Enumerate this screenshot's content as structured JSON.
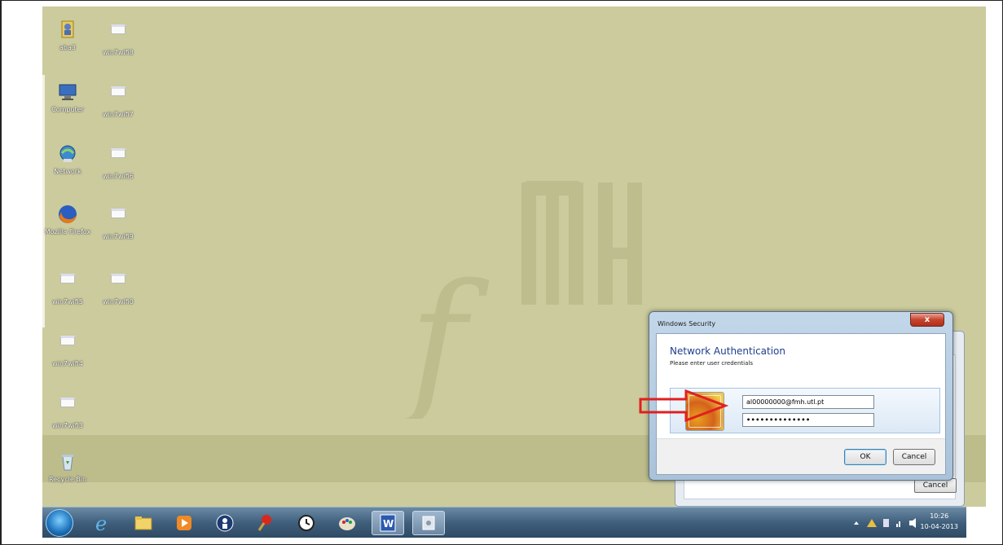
{
  "desktop": {
    "icons": [
      {
        "label": "aba3",
        "icon": "user-folder-icon"
      },
      {
        "label": "win7wifi8",
        "icon": "window-icon"
      },
      {
        "label": "Computer",
        "icon": "computer-icon"
      },
      {
        "label": "win7wifi7",
        "icon": "window-icon"
      },
      {
        "label": "Network",
        "icon": "network-icon"
      },
      {
        "label": "win7wifi6",
        "icon": "window-icon"
      },
      {
        "label": "Mozilla Firefox",
        "icon": "firefox-icon"
      },
      {
        "label": "win7wifi9",
        "icon": "window-icon"
      },
      {
        "label": "win7wifi5",
        "icon": "window-icon"
      },
      {
        "label": "win7wifi0",
        "icon": "window-icon"
      },
      {
        "label": "win7wifi4",
        "icon": "window-icon"
      },
      {
        "label": "win7wifi3",
        "icon": "window-icon"
      },
      {
        "label": "Recycle Bin",
        "icon": "recycle-bin-icon"
      }
    ],
    "wallpaper_color": "#cbcb9d"
  },
  "security_dialog": {
    "title": "Windows Security",
    "close_label": "x",
    "heading": "Network Authentication",
    "subheading": "Please enter user credentials",
    "username_value": "al00000000@fmh.utl.pt",
    "password_value": "••••••••••••••",
    "ok_label": "OK",
    "cancel_label": "Cancel"
  },
  "background_dialog": {
    "cancel_label": "Cancel"
  },
  "taskbar": {
    "items": [
      "start-orb",
      "internet-explorer-icon",
      "windows-explorer-icon",
      "media-player-icon",
      "app-icon",
      "pin-icon",
      "clock-app-icon",
      "paint-icon",
      "word-icon",
      "app-window-icon"
    ],
    "time": "10:26",
    "date": "10-04-2013"
  },
  "colors": {
    "arrow": "#e02020",
    "heading": "#1f3d8c"
  }
}
